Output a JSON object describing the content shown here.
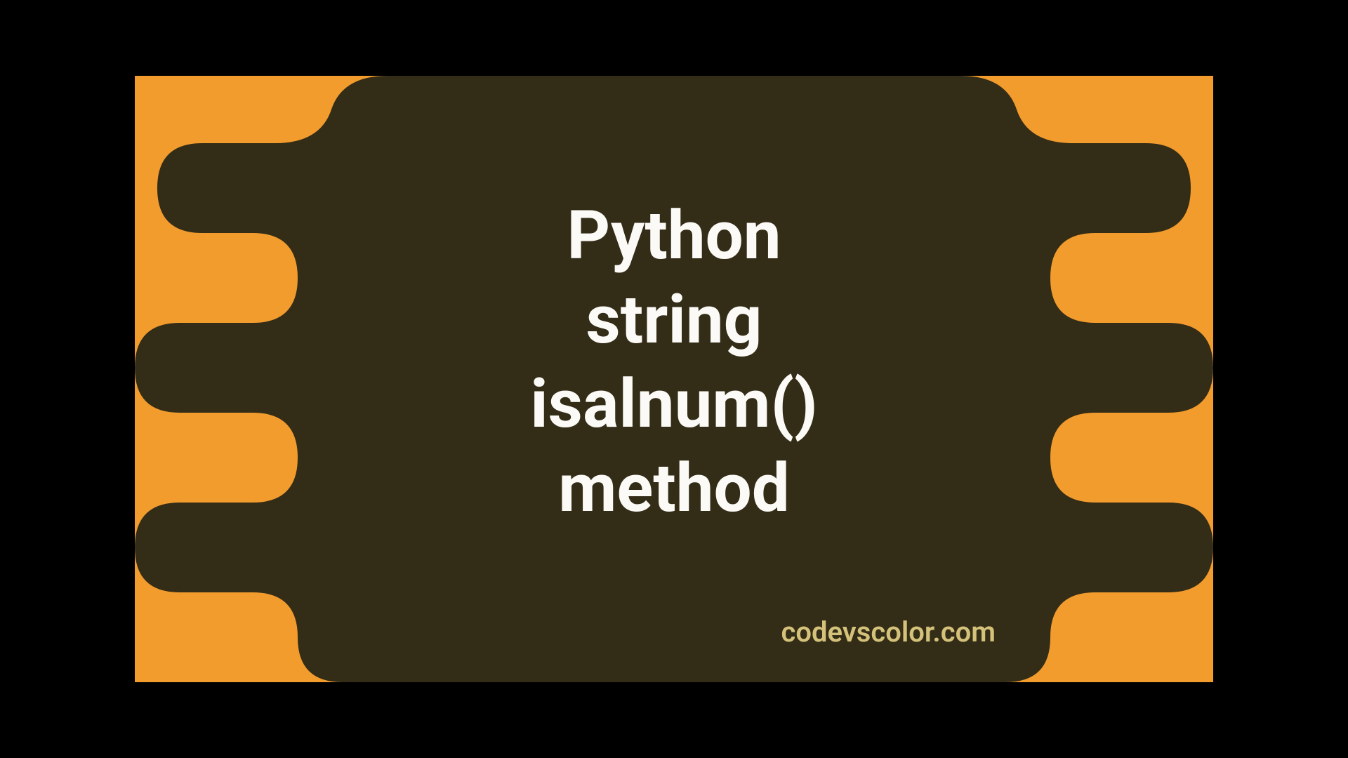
{
  "title_lines": {
    "line1": "Python",
    "line2": "string",
    "line3": "isalnum()",
    "line4": "method"
  },
  "watermark": "codevscolor.com",
  "colors": {
    "background": "#f39c2e",
    "blob": "#332c17",
    "title_text": "#fbfaf6",
    "watermark_text": "#d4c27a"
  }
}
